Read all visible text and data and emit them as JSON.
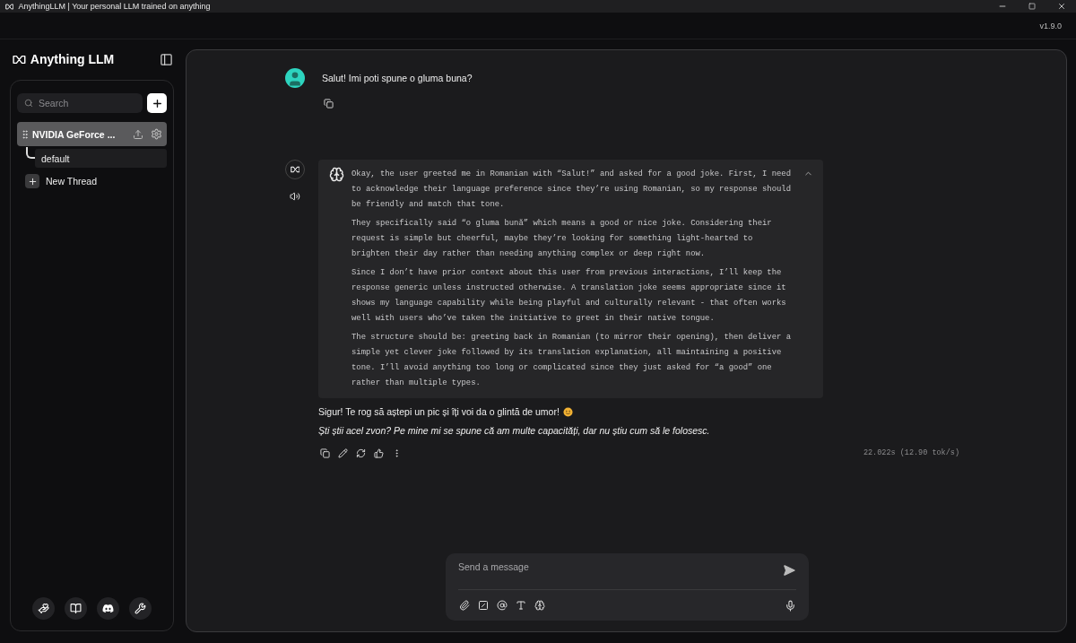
{
  "window": {
    "title": "AnythingLLM | Your personal LLM trained on anything"
  },
  "version": "v1.9.0",
  "sidebar": {
    "brand": "Anything LLM",
    "search": {
      "placeholder": "Search"
    },
    "workspace": {
      "name": "NVIDIA GeForce ...",
      "selected": true
    },
    "threads": [
      {
        "name": "default",
        "selected": true
      }
    ],
    "new_thread": "New Thread"
  },
  "messages": [
    {
      "kind": "user",
      "text": "Salut! Imi poti spune o gluma buna?"
    },
    {
      "kind": "assistant",
      "thought_expanded": true,
      "thought": [
        "Okay, the user greeted me in Romanian with “Salut!” and asked for a good joke. First, I need to acknowledge their language preference since they’re using Romanian, so my response should be friendly and match that tone.",
        "They specifically said “o gluma bună” which means a good or nice joke. Considering their request is simple but cheerful, maybe they’re looking for something light-hearted to brighten their day rather than needing anything complex or deep right now.",
        "Since I don’t have prior context about this user from previous interactions, I’ll keep the response generic unless instructed otherwise. A translation joke seems appropriate since it shows my language capability while being playful and culturally relevant - that often works well with users who’ve taken the initiative to greet in their native tongue.",
        "The structure should be: greeting back in Romanian (to mirror their opening), then deliver a simple yet clever joke followed by its translation explanation, all maintaining a positive tone. I’ll avoid anything too long or complicated since they just asked for “a good” one rather than multiple types."
      ],
      "paragraphs": [
        {
          "text": "Sigur! Te rog să aștepi un pic și îți voi da o glintă de umor!",
          "kind": "normal",
          "emoji": true
        },
        {
          "text": "Ști știi acel zvon? Pe mine mi se spune că am multe capacități, dar nu știu cum să le folosesc.",
          "kind": "emphasis",
          "emoji": false
        }
      ],
      "timing": "22.022s (12.90 tok/s)"
    }
  ],
  "composer": {
    "placeholder": "Send a message"
  }
}
